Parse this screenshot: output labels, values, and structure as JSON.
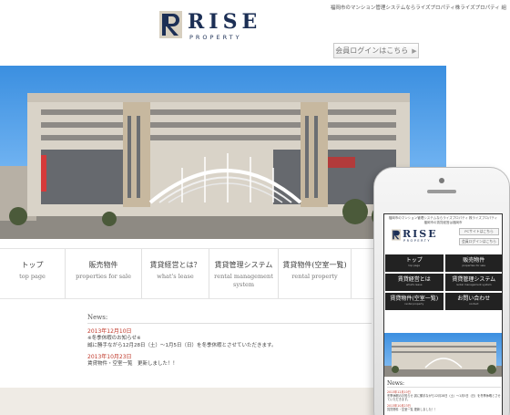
{
  "site": {
    "tagline": "福岡市のマンション管理システムならライズプロパティ株ライズプロパティ 組",
    "logo_main": "RISE",
    "logo_sub": "PROPERTY",
    "login_label": "会員ログインはこちら"
  },
  "nav": {
    "items": [
      {
        "jp": "トップ",
        "en": "top page"
      },
      {
        "jp": "販売物件",
        "en": "properties for sale"
      },
      {
        "jp": "賃貸経営とは？",
        "en": "what's lease"
      },
      {
        "jp": "賃貸管理システム",
        "en": "rental management system"
      },
      {
        "jp": "賃貸物件(空室一覧)",
        "en": "rental property"
      }
    ]
  },
  "news": {
    "title": "News:",
    "entries": [
      {
        "date": "2013年12月10日",
        "lines": [
          "※冬季休暇のお知らせ※",
          "誠に勝手ながら12月28日（土）～1月5日（日）を冬季休暇とさせていただきます。"
        ]
      },
      {
        "date": "2013年10月23日",
        "lines": [
          "賃貸物件・空室一覧　更新しました！！"
        ]
      }
    ]
  },
  "mobile": {
    "tagline": "福岡市のマンション管理システムならライズプロパティ 株ライズプロパティ 福岡市の賃貸経営は福岡市",
    "logo_main": "RISE",
    "logo_sub": "PROPERTY",
    "top_button": "PCサイトはこちら",
    "login_button": "会員ログインはこちら",
    "menu": [
      {
        "jp": "トップ",
        "en": "top page"
      },
      {
        "jp": "販売物件",
        "en": "properties for sale"
      },
      {
        "jp": "賃貸経営とは",
        "en": "what's lease"
      },
      {
        "jp": "賃貸管理システム",
        "en": "rental management system"
      },
      {
        "jp": "賃貸物件(空室一覧)",
        "en": "rental property"
      },
      {
        "jp": "お問い合わせ",
        "en": "contact"
      }
    ],
    "news_title": "News:",
    "news_date1": "2013年12月10日",
    "news_text1": "冬季休暇のお知らせ 誠に勝手ながら12月28日（土）～1月5日（日）を冬季休暇とさせていただきます。",
    "news_date2": "2013年10月23日",
    "news_text2": "賃貸物件・空室一覧 更新しました！！"
  },
  "colors": {
    "brand": "#1c2f55",
    "news_date": "#c0392b",
    "sky": "#3b8fe0",
    "footer": "#efebe5"
  }
}
